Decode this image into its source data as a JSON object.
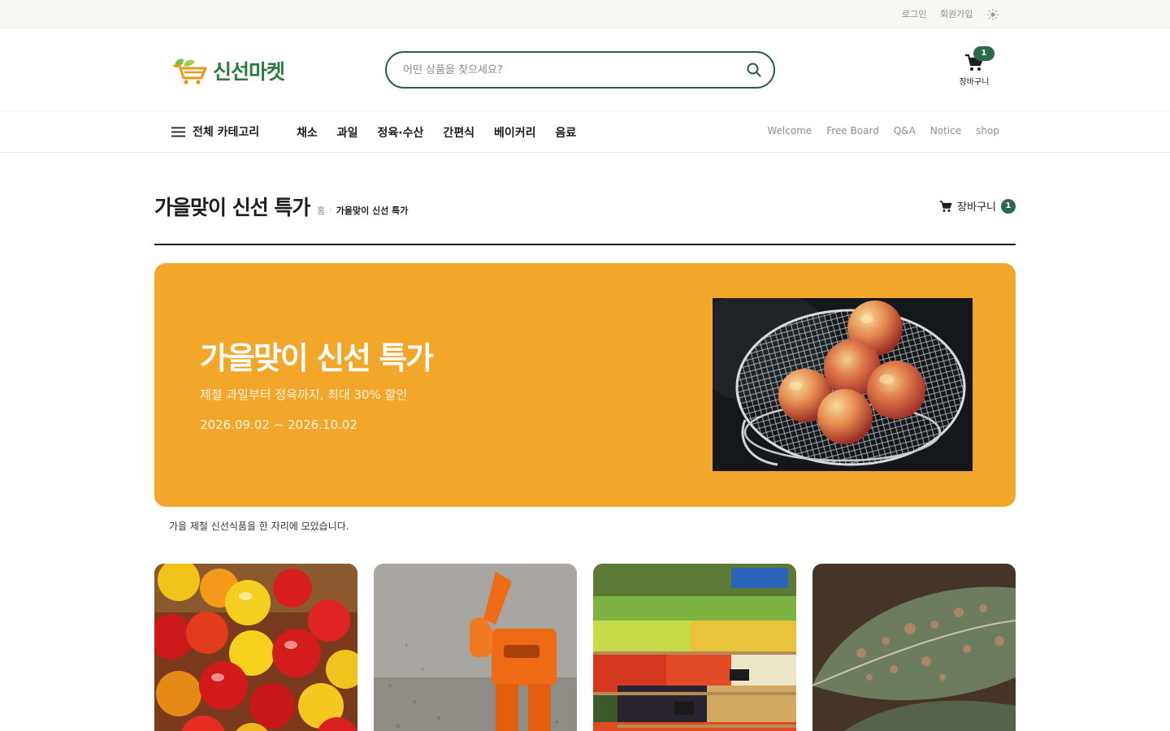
{
  "topbar": {
    "login": "로그인",
    "signup": "회원가입",
    "theme_icon": "sun-icon"
  },
  "header": {
    "logo_text": "신선마켓",
    "search_placeholder": "어떤 상품을 찾으세요?",
    "cart_label": "장바구니",
    "cart_count": "1"
  },
  "nav": {
    "all_categories": "전체 카테고리",
    "categories": [
      "채소",
      "과일",
      "정육·수산",
      "간편식",
      "베이커리",
      "음료"
    ],
    "boards": [
      "Welcome",
      "Free Board",
      "Q&A",
      "Notice",
      "shop"
    ]
  },
  "page": {
    "title": "가을맞이 신선 특가",
    "breadcrumb_home": "홈",
    "breadcrumb_current": "가을맞이 신선 특가",
    "cart_link_label": "장바구니",
    "cart_link_count": "1"
  },
  "banner": {
    "title": "가을맞이 신선 특가",
    "subtitle": "제철 과일부터 정육까지, 최대 30% 할인",
    "date": "2026.09.02 ~ 2026.10.02",
    "background_color": "#f3a72a"
  },
  "description": "가을 제철 신선식품을 한 자리에 모았습니다.",
  "colors": {
    "brand_green": "#2e7a3c",
    "badge_green": "#2b6a49",
    "banner_orange": "#f3a72a"
  }
}
